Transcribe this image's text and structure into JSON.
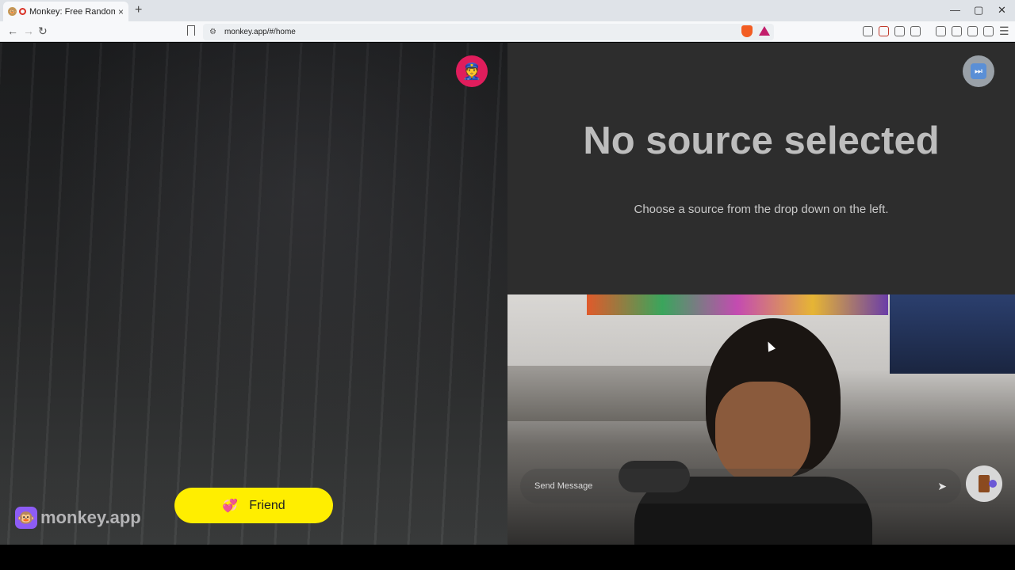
{
  "browser": {
    "tab_title": "Monkey: Free Random Video Chat",
    "tab_close": "×",
    "new_tab": "+",
    "url": "monkey.app/#/home",
    "back": "←",
    "forward": "→",
    "reload": "↻",
    "window_minimize": "—",
    "window_restore": "▢",
    "window_close": "✕"
  },
  "left_pane": {
    "report_icon": "police-officer-icon",
    "logo_text": "monkey.app",
    "friend_button_label": "Friend"
  },
  "right_pane": {
    "skip_icon": "next-track-icon",
    "no_source_title": "No source selected",
    "no_source_subtitle": "Choose a source from the drop down on the left.",
    "message_placeholder": "Send Message",
    "send_icon": "send-icon",
    "leave_icon": "door-exit-icon"
  },
  "colors": {
    "friend_button": "#ffee00",
    "report_button": "#e01d5c",
    "logo_badge": "#8d5cf5",
    "remote_panel_bg": "#2d2d2d"
  }
}
